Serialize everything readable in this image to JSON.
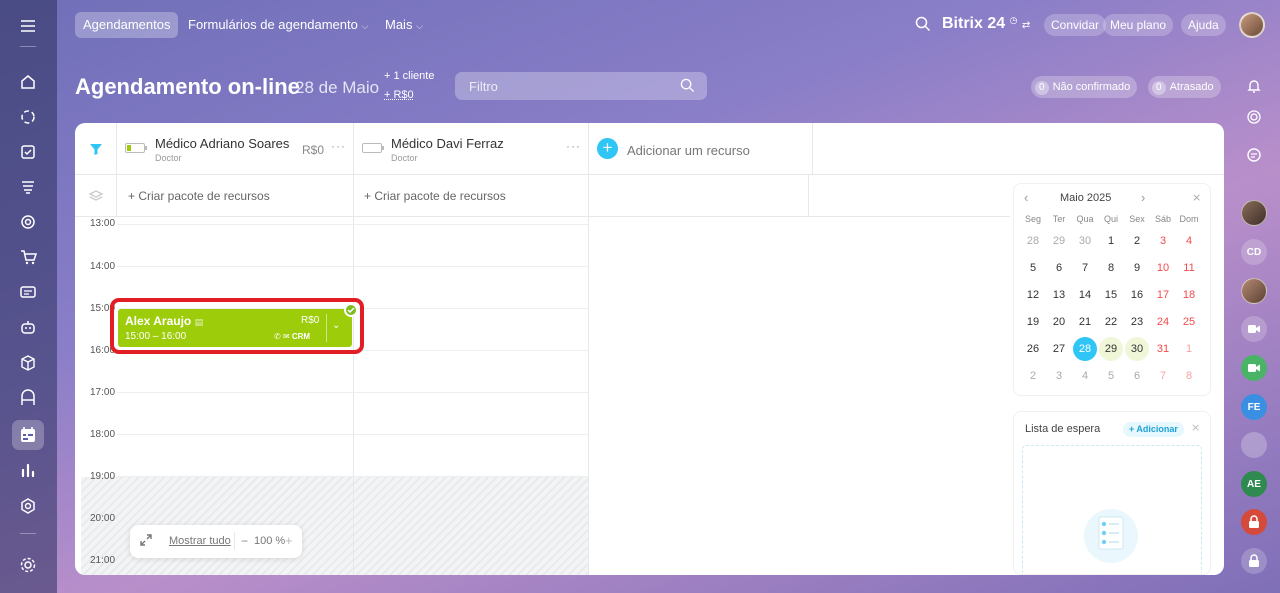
{
  "topbar": {
    "tabs": [
      {
        "label": "Agendamentos",
        "active": true
      },
      {
        "label": "Formulários de agendamento",
        "dropdown": true
      },
      {
        "label": "Mais",
        "dropdown": true
      }
    ],
    "brand": "Bitrix",
    "brand_num": "24",
    "invite": "Convidar",
    "my_plan": "Meu plano",
    "help": "Ajuda"
  },
  "header": {
    "title": "Agendamento on-line",
    "date": "28 de Maio",
    "clients": "+ 1 cliente",
    "money": "+ R$0",
    "filter_placeholder": "Filtro",
    "unconfirmed_count": "0",
    "unconfirmed_label": "Não confirmado",
    "late_count": "0",
    "late_label": "Atrasado"
  },
  "resources": [
    {
      "name": "Médico Adriano Soares",
      "role": "Doctor",
      "price": "R$0"
    },
    {
      "name": "Médico Davi Ferraz",
      "role": "Doctor",
      "price": ""
    }
  ],
  "add_resource": "Adicionar um recurso",
  "create_package": "+ Criar pacote de recursos",
  "times": [
    "13:00",
    "14:00",
    "15:00",
    "16:00",
    "17:00",
    "18:00",
    "19:00",
    "20:00",
    "21:00"
  ],
  "booking": {
    "client": "Alex Araujo",
    "price": "R$0",
    "time": "15:00 – 16:00",
    "crm": "CRM"
  },
  "zoom": {
    "show_all": "Mostrar tudo",
    "level": "100 %"
  },
  "calendar": {
    "month": "Maio 2025",
    "weekdays": [
      "Seg",
      "Ter",
      "Qua",
      "Qui",
      "Sex",
      "Sáb",
      "Dom"
    ],
    "weeks": [
      [
        "28",
        "29",
        "30",
        "1",
        "2",
        "3",
        "4"
      ],
      [
        "5",
        "6",
        "7",
        "8",
        "9",
        "10",
        "11"
      ],
      [
        "12",
        "13",
        "14",
        "15",
        "16",
        "17",
        "18"
      ],
      [
        "19",
        "20",
        "21",
        "22",
        "23",
        "24",
        "25"
      ],
      [
        "26",
        "27",
        "28",
        "29",
        "30",
        "31",
        "1"
      ],
      [
        "2",
        "3",
        "4",
        "5",
        "6",
        "7",
        "8"
      ]
    ],
    "today": "28"
  },
  "waitlist": {
    "title": "Lista de espera",
    "add": "+ Adicionar"
  },
  "right_rail": {
    "avatars": [
      "CD",
      "FE",
      "AE"
    ]
  },
  "colors": {
    "booking": "#9dcc0a",
    "highlight": "#e01e24",
    "today": "#2fc6f6",
    "weekend": "#f24b4b"
  }
}
